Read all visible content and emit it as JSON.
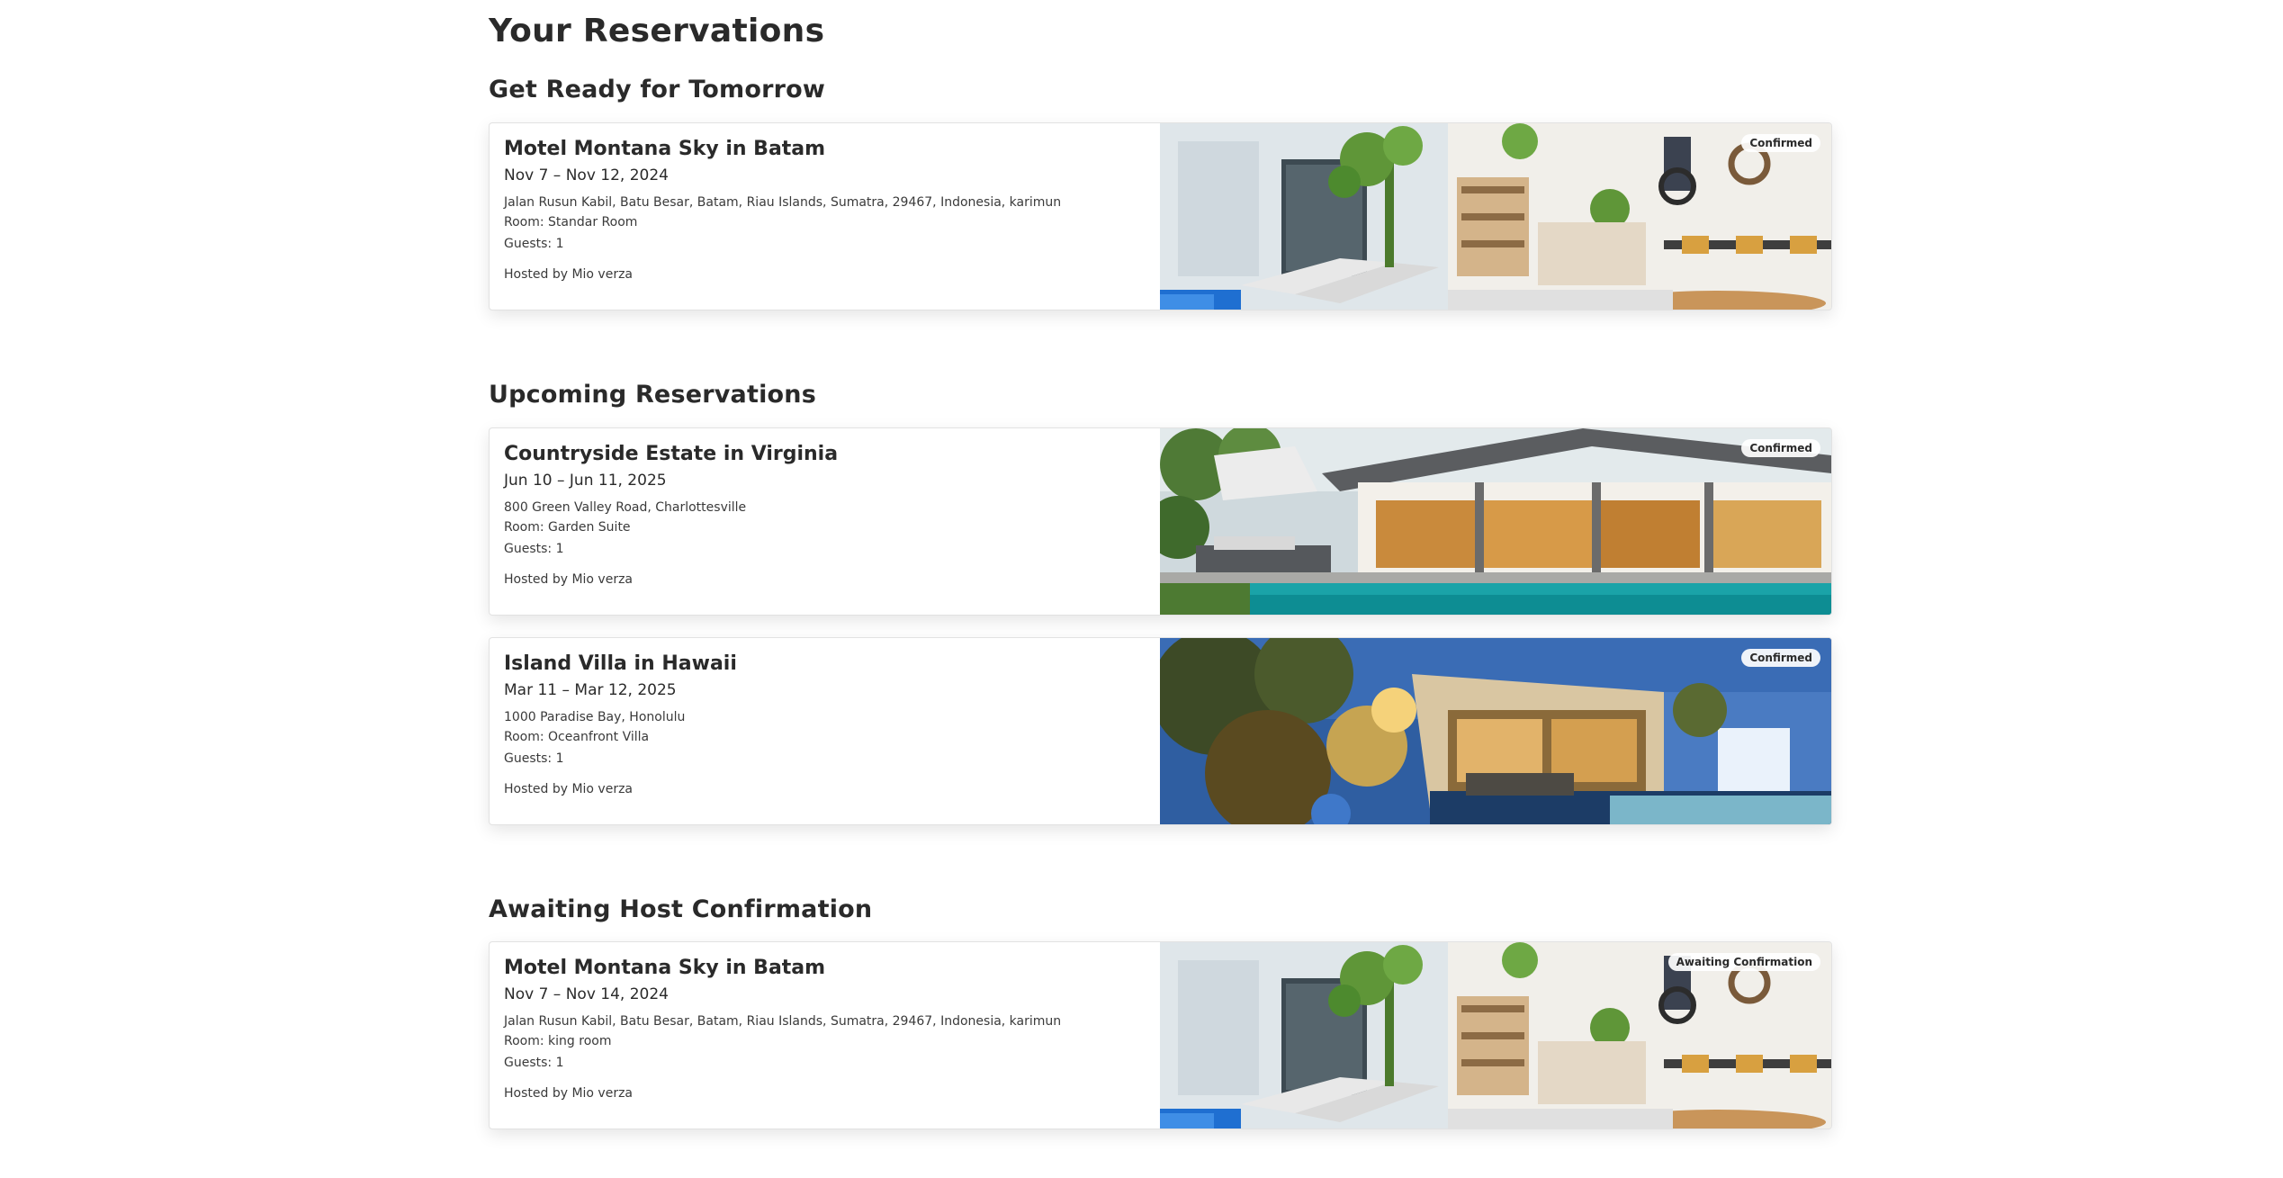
{
  "page_title": "Your Reservations",
  "sections": [
    {
      "title": "Get Ready for Tomorrow",
      "cards": [
        {
          "name": "Motel Montana Sky in Batam",
          "dates": "Nov 7 – Nov 12, 2024",
          "address": "Jalan Rusun Kabil, Batu Besar, Batam, Riau Islands, Sumatra, 29467, Indonesia, karimun",
          "room": "Room: Standar Room",
          "guests": "Guests: 1",
          "host": "Hosted by Mio verza",
          "status": "Confirmed",
          "image": "motel-interior-photo"
        }
      ]
    },
    {
      "title": "Upcoming Reservations",
      "cards": [
        {
          "name": "Countryside Estate in Virginia",
          "dates": "Jun 10 – Jun 11, 2025",
          "address": "800 Green Valley Road, Charlottesville",
          "room": "Room: Garden Suite",
          "guests": "Guests: 1",
          "host": "Hosted by Mio verza",
          "status": "Confirmed",
          "image": "estate-pool-photo"
        },
        {
          "name": "Island Villa in Hawaii",
          "dates": "Mar 11 – Mar 12, 2025",
          "address": "1000 Paradise Bay, Honolulu",
          "room": "Room: Oceanfront Villa",
          "guests": "Guests: 1",
          "host": "Hosted by Mio verza",
          "status": "Confirmed",
          "image": "villa-night-photo"
        }
      ]
    },
    {
      "title": "Awaiting Host Confirmation",
      "cards": [
        {
          "name": "Motel Montana Sky in Batam",
          "dates": "Nov 7 – Nov 14, 2024",
          "address": "Jalan Rusun Kabil, Batu Besar, Batam, Riau Islands, Sumatra, 29467, Indonesia, karimun",
          "room": "Room: king room",
          "guests": "Guests: 1",
          "host": "Hosted by Mio verza",
          "status": "Awaiting Confirmation",
          "image": "motel-interior-photo"
        }
      ]
    }
  ]
}
